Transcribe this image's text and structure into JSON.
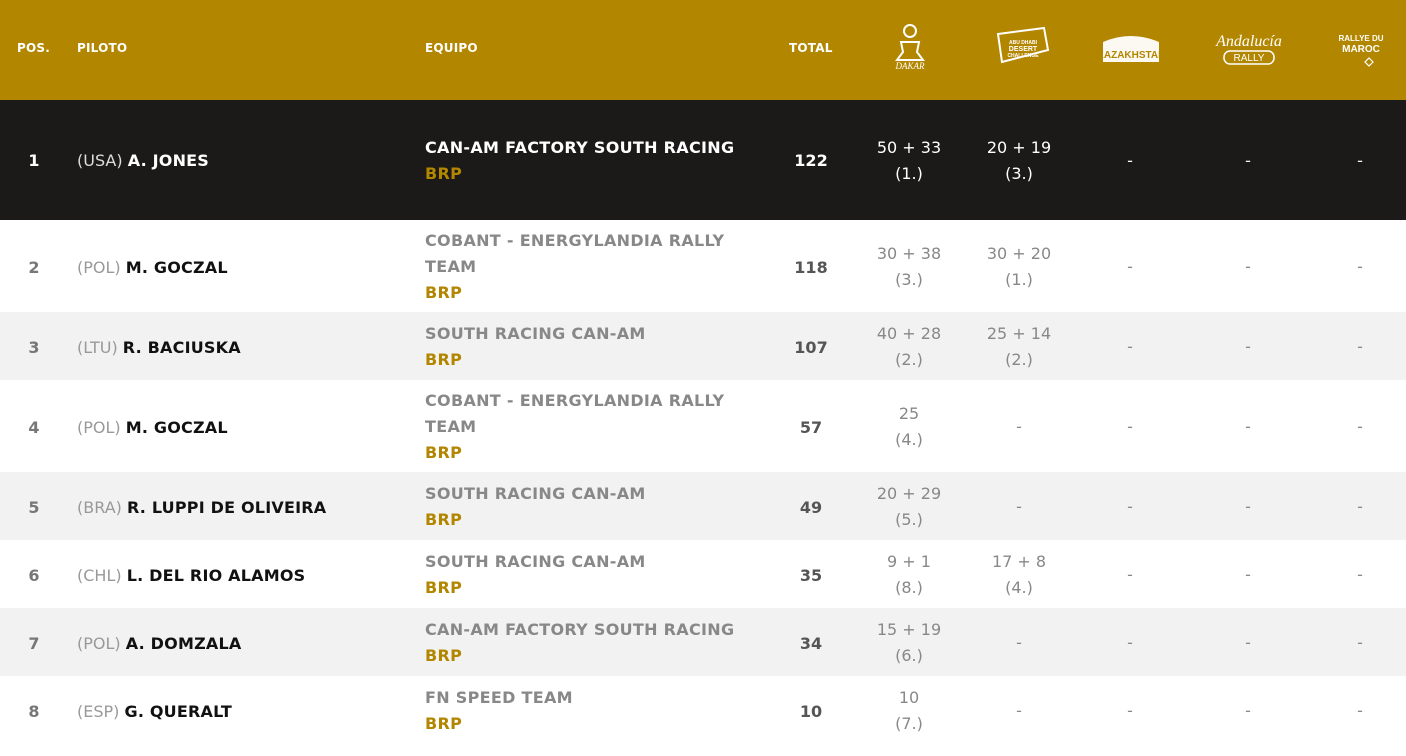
{
  "header": {
    "pos": "POS.",
    "pilot": "PILOTO",
    "team": "EQUIPO",
    "total": "TOTAL",
    "events": [
      {
        "icon": "dakar-logo-icon",
        "text": "DAKAR"
      },
      {
        "icon": "abu-dhabi-desert-challenge-logo-icon",
        "text": "ABU DHABI DESERT CHALLENGE"
      },
      {
        "icon": "rallye-kazakhstan-logo-icon",
        "text": "KAZAKHSTAN"
      },
      {
        "icon": "andalucia-rally-logo-icon",
        "text": "Andalucía RALLY"
      },
      {
        "icon": "rallye-du-maroc-logo-icon",
        "text": "RALLYE DU MAROC"
      }
    ]
  },
  "colors": {
    "gold": "#b38600",
    "dark_row": "#1b1a19",
    "alt_row": "#f2f2f2"
  },
  "rows": [
    {
      "pos": "1",
      "nat": "(USA)",
      "name": "A. JONES",
      "team": "CAN-AM FACTORY SOUTH RACING",
      "brand": "BRP",
      "total": "122",
      "e1_pts": "50 + 33",
      "e1_rank": "(1.)",
      "e2_pts": "20 + 19",
      "e2_rank": "(3.)",
      "e3": "-",
      "e4": "-",
      "e5": "-"
    },
    {
      "pos": "2",
      "nat": "(POL)",
      "name": "M. GOCZAL",
      "team": "COBANT - ENERGYLANDIA RALLY TEAM",
      "brand": "BRP",
      "total": "118",
      "e1_pts": "30 + 38",
      "e1_rank": "(3.)",
      "e2_pts": "30 + 20",
      "e2_rank": "(1.)",
      "e3": "-",
      "e4": "-",
      "e5": "-"
    },
    {
      "pos": "3",
      "nat": "(LTU)",
      "name": "R. BACIUSKA",
      "team": "SOUTH RACING CAN-AM",
      "brand": "BRP",
      "total": "107",
      "e1_pts": "40 + 28",
      "e1_rank": "(2.)",
      "e2_pts": "25 + 14",
      "e2_rank": "(2.)",
      "e3": "-",
      "e4": "-",
      "e5": "-"
    },
    {
      "pos": "4",
      "nat": "(POL)",
      "name": "M. GOCZAL",
      "team": "COBANT - ENERGYLANDIA RALLY TEAM",
      "brand": "BRP",
      "total": "57",
      "e1_pts": "25",
      "e1_rank": "(4.)",
      "e2": "-",
      "e3": "-",
      "e4": "-",
      "e5": "-"
    },
    {
      "pos": "5",
      "nat": "(BRA)",
      "name": "R. LUPPI DE OLIVEIRA",
      "team": "SOUTH RACING CAN-AM",
      "brand": "BRP",
      "total": "49",
      "e1_pts": "20 + 29",
      "e1_rank": "(5.)",
      "e2": "-",
      "e3": "-",
      "e4": "-",
      "e5": "-"
    },
    {
      "pos": "6",
      "nat": "(CHL)",
      "name": "L. DEL RIO ALAMOS",
      "team": "SOUTH RACING CAN-AM",
      "brand": "BRP",
      "total": "35",
      "e1_pts": "9 + 1",
      "e1_rank": "(8.)",
      "e2_pts": "17 + 8",
      "e2_rank": "(4.)",
      "e3": "-",
      "e4": "-",
      "e5": "-"
    },
    {
      "pos": "7",
      "nat": "(POL)",
      "name": "A. DOMZALA",
      "team": "CAN-AM FACTORY SOUTH RACING",
      "brand": "BRP",
      "total": "34",
      "e1_pts": "15 + 19",
      "e1_rank": "(6.)",
      "e2": "-",
      "e3": "-",
      "e4": "-",
      "e5": "-"
    },
    {
      "pos": "8",
      "nat": "(ESP)",
      "name": "G. QUERALT",
      "team": "FN SPEED TEAM",
      "brand": "BRP",
      "total": "10",
      "e1_pts": "10",
      "e1_rank": "(7.)",
      "e2": "-",
      "e3": "-",
      "e4": "-",
      "e5": "-"
    }
  ]
}
